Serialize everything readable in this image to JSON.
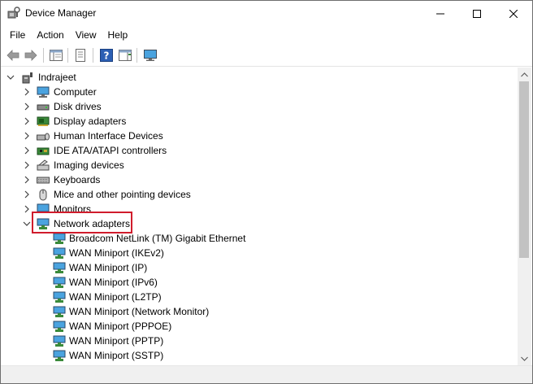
{
  "window": {
    "title": "Device Manager"
  },
  "menu": {
    "file": "File",
    "action": "Action",
    "view": "View",
    "help": "Help"
  },
  "tree": {
    "root": "Indrajeet",
    "categories": [
      {
        "label": "Computer",
        "icon": "computer-icon"
      },
      {
        "label": "Disk drives",
        "icon": "disk-drive-icon"
      },
      {
        "label": "Display adapters",
        "icon": "display-adapter-icon"
      },
      {
        "label": "Human Interface Devices",
        "icon": "hid-icon"
      },
      {
        "label": "IDE ATA/ATAPI controllers",
        "icon": "ide-controller-icon"
      },
      {
        "label": "Imaging devices",
        "icon": "imaging-device-icon"
      },
      {
        "label": "Keyboards",
        "icon": "keyboard-icon"
      },
      {
        "label": "Mice and other pointing devices",
        "icon": "mouse-icon"
      },
      {
        "label": "Monitors",
        "icon": "monitor-icon"
      },
      {
        "label": "Network adapters",
        "icon": "network-adapter-icon",
        "expanded": true
      }
    ],
    "network_children": [
      "Broadcom NetLink (TM) Gigabit Ethernet",
      "WAN Miniport (IKEv2)",
      "WAN Miniport (IP)",
      "WAN Miniport (IPv6)",
      "WAN Miniport (L2TP)",
      "WAN Miniport (Network Monitor)",
      "WAN Miniport (PPPOE)",
      "WAN Miniport (PPTP)",
      "WAN Miniport (SSTP)"
    ]
  },
  "colors": {
    "highlight_border": "#d01c2c",
    "scroll_thumb": "#c2c2c2"
  }
}
